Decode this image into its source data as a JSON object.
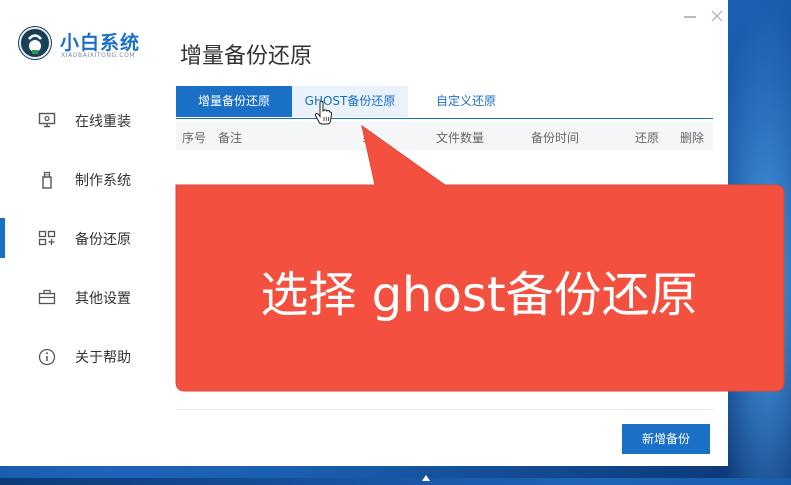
{
  "app": {
    "name": "小白系统",
    "subtitle": "XIAOBAIXITONG.COM"
  },
  "sidebar": {
    "items": [
      {
        "label": "在线重装",
        "icon": "monitor-icon",
        "active": false
      },
      {
        "label": "制作系统",
        "icon": "usb-drive-icon",
        "active": false
      },
      {
        "label": "备份还原",
        "icon": "backup-grid-icon",
        "active": true
      },
      {
        "label": "其他设置",
        "icon": "briefcase-icon",
        "active": false
      },
      {
        "label": "关于帮助",
        "icon": "info-icon",
        "active": false
      }
    ]
  },
  "main": {
    "title": "增量备份还原",
    "tabs": [
      {
        "label": "增量备份还原",
        "selected": true
      },
      {
        "label": "GHOST备份还原",
        "selected": false,
        "hovered": true
      },
      {
        "label": "自定义还原",
        "selected": false
      }
    ],
    "table": {
      "columns": [
        "序号",
        "备注",
        "系",
        "文件数量",
        "备份时间",
        "还原",
        "删除"
      ]
    },
    "add_button_label": "新增备份"
  },
  "callout": {
    "text": "选择 ghost备份还原",
    "color": "#f4503f"
  },
  "colors": {
    "accent": "#1a6fc7",
    "desktop": "#1d63b8"
  }
}
